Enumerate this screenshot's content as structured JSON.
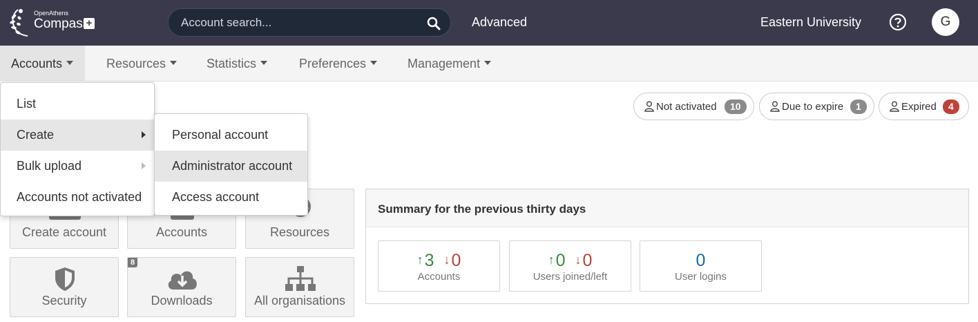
{
  "header": {
    "logo_small": "OpenAthens",
    "logo_big": "Compass",
    "logo_plus": "+",
    "search_placeholder": "Account search...",
    "advanced": "Advanced",
    "organisation": "Eastern University",
    "avatar_initial": "G",
    "bg_color": "#3b3a4d"
  },
  "nav": {
    "items": [
      {
        "label": "Accounts"
      },
      {
        "label": "Resources"
      },
      {
        "label": "Statistics"
      },
      {
        "label": "Preferences"
      },
      {
        "label": "Management"
      }
    ]
  },
  "accounts_menu": {
    "items": [
      {
        "label": "List"
      },
      {
        "label": "Create"
      },
      {
        "label": "Bulk upload"
      },
      {
        "label": "Accounts not activated"
      }
    ]
  },
  "create_submenu": {
    "items": [
      {
        "label": "Personal account"
      },
      {
        "label": "Administrator account"
      },
      {
        "label": "Access account"
      }
    ]
  },
  "status": {
    "not_activated": {
      "label": "Not activated",
      "count": "10",
      "color": "#8a8a8a"
    },
    "due_to_expire": {
      "label": "Due to expire",
      "count": "1",
      "color": "#8a8a8a"
    },
    "expired": {
      "label": "Expired",
      "count": "4",
      "color": "#c0413b"
    }
  },
  "tiles": {
    "create_account": "Create account",
    "accounts": "Accounts",
    "resources": "Resources",
    "security": "Security",
    "downloads": "Downloads",
    "downloads_badge": "8",
    "all_organisations": "All organisations"
  },
  "summary": {
    "title": "Summary for the previous thirty days",
    "accounts": {
      "up": "3",
      "down": "0",
      "label": "Accounts"
    },
    "users": {
      "up": "0",
      "down": "0",
      "label": "Users joined/left"
    },
    "logins": {
      "value": "0",
      "label": "User logins"
    }
  }
}
